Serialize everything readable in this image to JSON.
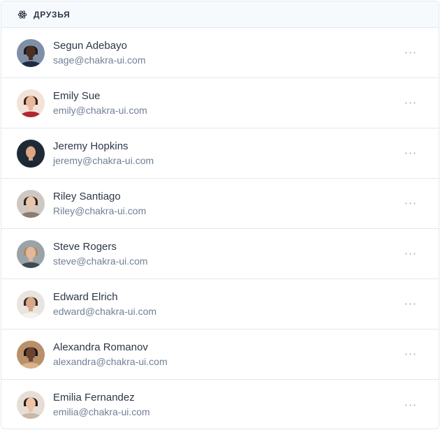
{
  "header": {
    "title": "ДРУЗЬЯ",
    "icon": "react-atom-icon"
  },
  "more_label": "···",
  "friends": [
    {
      "name": "Segun Adebayo",
      "email": "sage@chakra-ui.com",
      "avatar_bg": "#7f8fa6",
      "skin": "#4a2f23",
      "hair": "#1a1a1a",
      "shirt": "#1f2a44"
    },
    {
      "name": "Emily Sue",
      "email": "emily@chakra-ui.com",
      "avatar_bg": "#f2e2d8",
      "skin": "#e8b89b",
      "hair": "#3b2116",
      "shirt": "#b3262f"
    },
    {
      "name": "Jeremy Hopkins",
      "email": "jeremy@chakra-ui.com",
      "avatar_bg": "#1e2a36",
      "skin": "#d9a888",
      "hair": "#2b2420",
      "shirt": "#1b2630"
    },
    {
      "name": "Riley Santiago",
      "email": "Riley@chakra-ui.com",
      "avatar_bg": "#cfc8c2",
      "skin": "#e7c4ad",
      "hair": "#2e1f18",
      "shirt": "#8d7c70"
    },
    {
      "name": "Steve Rogers",
      "email": "steve@chakra-ui.com",
      "avatar_bg": "#9aa3a8",
      "skin": "#e3b89c",
      "hair": "#b08a5a",
      "shirt": "#3f4a52"
    },
    {
      "name": "Edward Elrich",
      "email": "edward@chakra-ui.com",
      "avatar_bg": "#e9e4df",
      "skin": "#d7a78a",
      "hair": "#3a2a22",
      "shirt": "#f4f1ee"
    },
    {
      "name": "Alexandra Romanov",
      "email": "alexandra@chakra-ui.com",
      "avatar_bg": "#b8906a",
      "skin": "#6b4330",
      "hair": "#1c130f",
      "shirt": "#d8b48a"
    },
    {
      "name": "Emilia Fernandez",
      "email": "emilia@chakra-ui.com",
      "avatar_bg": "#e6ded6",
      "skin": "#edc3a4",
      "hair": "#2b1a12",
      "shirt": "#c9b8a8"
    }
  ]
}
